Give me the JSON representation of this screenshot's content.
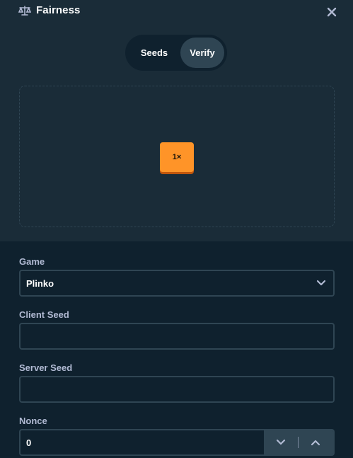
{
  "modal": {
    "title": "Fairness",
    "title_icon": "scale-icon",
    "close_icon": "close-icon"
  },
  "tabs": [
    {
      "label": "Seeds",
      "active": false
    },
    {
      "label": "Verify",
      "active": true
    }
  ],
  "preview": {
    "multiplier": "1×",
    "chip_color": "#ff9428"
  },
  "form": {
    "game": {
      "label": "Game",
      "value": "Plinko",
      "icon": "chevron-down-icon"
    },
    "client_seed": {
      "label": "Client Seed",
      "value": ""
    },
    "server_seed": {
      "label": "Server Seed",
      "value": ""
    },
    "nonce": {
      "label": "Nonce",
      "value": "0",
      "decrement_icon": "chevron-down-icon",
      "increment_icon": "chevron-up-icon"
    }
  },
  "colors": {
    "panel": "#1a2c38",
    "form_bg": "#0f212e",
    "border": "#2f4553",
    "label": "#b1bad3",
    "accent": "#ff9428"
  }
}
